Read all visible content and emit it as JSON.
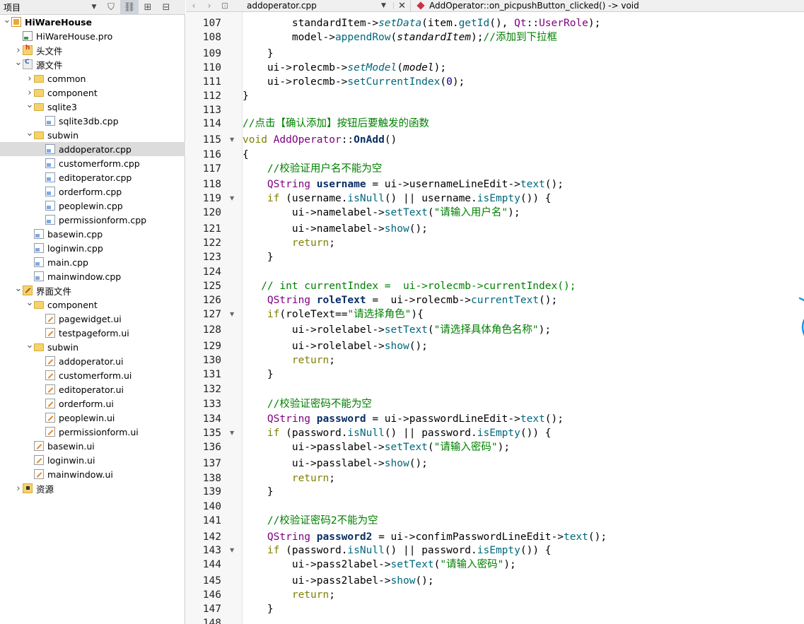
{
  "sidebar": {
    "title": "项目",
    "tree": [
      {
        "label": "HiWareHouse",
        "depth": 0,
        "icon": "project",
        "tw": "open",
        "bold": true
      },
      {
        "label": "HiWareHouse.pro",
        "depth": 1,
        "icon": "pro",
        "tw": ""
      },
      {
        "label": "头文件",
        "depth": 1,
        "icon": "hfolder",
        "tw": "closed"
      },
      {
        "label": "源文件",
        "depth": 1,
        "icon": "srcfolder",
        "tw": "open"
      },
      {
        "label": "common",
        "depth": 2,
        "icon": "folder",
        "tw": "closed"
      },
      {
        "label": "component",
        "depth": 2,
        "icon": "folder",
        "tw": "closed"
      },
      {
        "label": "sqlite3",
        "depth": 2,
        "icon": "folder",
        "tw": "open"
      },
      {
        "label": "sqlite3db.cpp",
        "depth": 3,
        "icon": "file",
        "tw": ""
      },
      {
        "label": "subwin",
        "depth": 2,
        "icon": "folder",
        "tw": "open"
      },
      {
        "label": "addoperator.cpp",
        "depth": 3,
        "icon": "file",
        "tw": "",
        "selected": true
      },
      {
        "label": "customerform.cpp",
        "depth": 3,
        "icon": "file",
        "tw": ""
      },
      {
        "label": "editoperator.cpp",
        "depth": 3,
        "icon": "file",
        "tw": ""
      },
      {
        "label": "orderform.cpp",
        "depth": 3,
        "icon": "file",
        "tw": ""
      },
      {
        "label": "peoplewin.cpp",
        "depth": 3,
        "icon": "file",
        "tw": ""
      },
      {
        "label": "permissionform.cpp",
        "depth": 3,
        "icon": "file",
        "tw": ""
      },
      {
        "label": "basewin.cpp",
        "depth": 2,
        "icon": "file",
        "tw": ""
      },
      {
        "label": "loginwin.cpp",
        "depth": 2,
        "icon": "file",
        "tw": ""
      },
      {
        "label": "main.cpp",
        "depth": 2,
        "icon": "file",
        "tw": ""
      },
      {
        "label": "mainwindow.cpp",
        "depth": 2,
        "icon": "file",
        "tw": ""
      },
      {
        "label": "界面文件",
        "depth": 1,
        "icon": "uifolder",
        "tw": "open"
      },
      {
        "label": "component",
        "depth": 2,
        "icon": "folder",
        "tw": "open"
      },
      {
        "label": "pagewidget.ui",
        "depth": 3,
        "icon": "ui",
        "tw": ""
      },
      {
        "label": "testpageform.ui",
        "depth": 3,
        "icon": "ui",
        "tw": ""
      },
      {
        "label": "subwin",
        "depth": 2,
        "icon": "folder",
        "tw": "open"
      },
      {
        "label": "addoperator.ui",
        "depth": 3,
        "icon": "ui",
        "tw": ""
      },
      {
        "label": "customerform.ui",
        "depth": 3,
        "icon": "ui",
        "tw": ""
      },
      {
        "label": "editoperator.ui",
        "depth": 3,
        "icon": "ui",
        "tw": ""
      },
      {
        "label": "orderform.ui",
        "depth": 3,
        "icon": "ui",
        "tw": ""
      },
      {
        "label": "peoplewin.ui",
        "depth": 3,
        "icon": "ui",
        "tw": ""
      },
      {
        "label": "permissionform.ui",
        "depth": 3,
        "icon": "ui",
        "tw": ""
      },
      {
        "label": "basewin.ui",
        "depth": 2,
        "icon": "ui",
        "tw": ""
      },
      {
        "label": "loginwin.ui",
        "depth": 2,
        "icon": "ui",
        "tw": ""
      },
      {
        "label": "mainwindow.ui",
        "depth": 2,
        "icon": "ui",
        "tw": ""
      },
      {
        "label": "资源",
        "depth": 1,
        "icon": "resfolder",
        "tw": "closed"
      }
    ]
  },
  "editor": {
    "file_name": "addoperator.cpp",
    "function_label": "AddOperator::on_picpushButton_clicked() -> void",
    "lines": [
      {
        "n": "107",
        "fold": false,
        "html": "        standardItem-><span class='vfn'>setData</span>(item.<span class='fn'>getId</span>(), <span class='ns'>Qt</span>::<span class='ty'>UserRole</span>);"
      },
      {
        "n": "108",
        "fold": false,
        "html": "        model-><span class='fn'>appendRow</span>(<span class='it'>standardItem</span>);<span class='cm'>//添加到下拉框</span>"
      },
      {
        "n": "109",
        "fold": false,
        "html": "    }"
      },
      {
        "n": "110",
        "fold": false,
        "html": "    ui->rolecmb-><span class='vfn'>setModel</span>(<span class='it'>model</span>);"
      },
      {
        "n": "111",
        "fold": false,
        "html": "    ui->rolecmb-><span class='fn'>setCurrentIndex</span>(<span class='num'>0</span>);"
      },
      {
        "n": "112",
        "fold": false,
        "html": "}"
      },
      {
        "n": "113",
        "fold": false,
        "html": ""
      },
      {
        "n": "114",
        "fold": false,
        "html": "<span class='cm'>//点击【确认添加】按钮后要触发的函数</span>"
      },
      {
        "n": "115",
        "fold": true,
        "html": "<span class='kw'>void</span> <span class='ty'>AddOperator</span>::<span class='bold'>OnAdd</span>()"
      },
      {
        "n": "116",
        "fold": false,
        "html": "{"
      },
      {
        "n": "117",
        "fold": false,
        "html": "    <span class='cm'>//校验证用户名不能为空</span>"
      },
      {
        "n": "118",
        "fold": false,
        "html": "    <span class='ty'>QString</span> <span class='bold'>username</span> = ui->usernameLineEdit-><span class='fn'>text</span>();"
      },
      {
        "n": "119",
        "fold": true,
        "html": "    <span class='kw'>if</span> (username.<span class='fn'>isNull</span>() || username.<span class='fn'>isEmpty</span>()) {"
      },
      {
        "n": "120",
        "fold": false,
        "html": "        ui->namelabel-><span class='fn'>setText</span>(<span class='st'>\"请输入用户名\"</span>);"
      },
      {
        "n": "121",
        "fold": false,
        "html": "        ui->namelabel-><span class='fn'>show</span>();"
      },
      {
        "n": "122",
        "fold": false,
        "html": "        <span class='kw'>return</span>;"
      },
      {
        "n": "123",
        "fold": false,
        "html": "    }"
      },
      {
        "n": "124",
        "fold": false,
        "html": ""
      },
      {
        "n": "125",
        "fold": false,
        "html": "   <span class='cm'>// int currentIndex =  ui->rolecmb->currentIndex();</span>"
      },
      {
        "n": "126",
        "fold": false,
        "html": "    <span class='ty'>QString</span> <span class='bold'>roleText</span> =  ui->rolecmb-><span class='fn'>currentText</span>();"
      },
      {
        "n": "127",
        "fold": true,
        "html": "    <span class='kw'>if</span>(roleText==<span class='st'>\"请选择角色\"</span>){"
      },
      {
        "n": "128",
        "fold": false,
        "html": "        ui->rolelabel-><span class='fn'>setText</span>(<span class='st'>\"请选择具体角色名称\"</span>);"
      },
      {
        "n": "129",
        "fold": false,
        "html": "        ui->rolelabel-><span class='fn'>show</span>();"
      },
      {
        "n": "130",
        "fold": false,
        "html": "        <span class='kw'>return</span>;"
      },
      {
        "n": "131",
        "fold": false,
        "html": "    }"
      },
      {
        "n": "132",
        "fold": false,
        "html": ""
      },
      {
        "n": "133",
        "fold": false,
        "html": "    <span class='cm'>//校验证密码不能为空</span>"
      },
      {
        "n": "134",
        "fold": false,
        "html": "    <span class='ty'>QString</span> <span class='bold'>password</span> = ui->passwordLineEdit-><span class='fn'>text</span>();"
      },
      {
        "n": "135",
        "fold": true,
        "html": "    <span class='kw'>if</span> (password.<span class='fn'>isNull</span>() || password.<span class='fn'>isEmpty</span>()) {"
      },
      {
        "n": "136",
        "fold": false,
        "html": "        ui->passlabel-><span class='fn'>setText</span>(<span class='st'>\"请输入密码\"</span>);"
      },
      {
        "n": "137",
        "fold": false,
        "html": "        ui->passlabel-><span class='fn'>show</span>();"
      },
      {
        "n": "138",
        "fold": false,
        "html": "        <span class='kw'>return</span>;"
      },
      {
        "n": "139",
        "fold": false,
        "html": "    }"
      },
      {
        "n": "140",
        "fold": false,
        "html": ""
      },
      {
        "n": "141",
        "fold": false,
        "html": "    <span class='cm'>//校验证密码2不能为空</span>"
      },
      {
        "n": "142",
        "fold": false,
        "html": "    <span class='ty'>QString</span> <span class='bold'>password2</span> = ui->confimPasswordLineEdit-><span class='fn'>text</span>();"
      },
      {
        "n": "143",
        "fold": true,
        "html": "    <span class='kw'>if</span> (password.<span class='fn'>isNull</span>() || password.<span class='fn'>isEmpty</span>()) {"
      },
      {
        "n": "144",
        "fold": false,
        "html": "        ui->pass2label-><span class='fn'>setText</span>(<span class='st'>\"请输入密码\"</span>);"
      },
      {
        "n": "145",
        "fold": false,
        "html": "        ui->pass2label-><span class='fn'>show</span>();"
      },
      {
        "n": "146",
        "fold": false,
        "html": "        <span class='kw'>return</span>;"
      },
      {
        "n": "147",
        "fold": false,
        "html": "    }"
      },
      {
        "n": "148",
        "fold": false,
        "html": ""
      }
    ]
  },
  "colors": {
    "selection": "#dcdcdc",
    "annotation": "#1e8fe0"
  }
}
